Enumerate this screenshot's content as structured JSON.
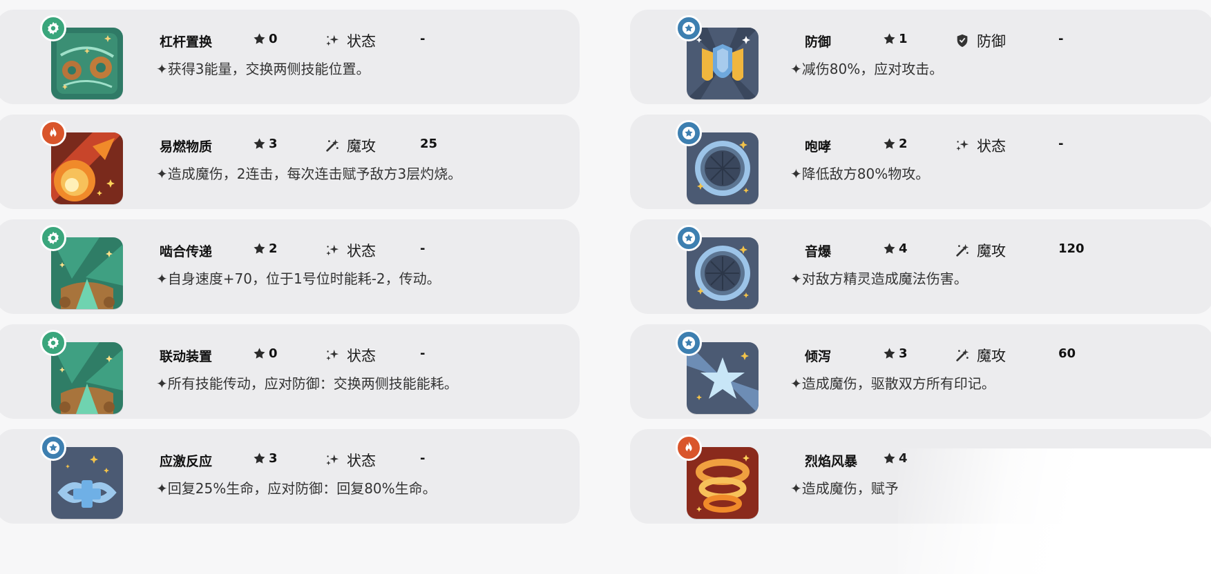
{
  "colors": {
    "card_bg": "#ececee",
    "badge_gear": "#3aa67c",
    "badge_star": "#3d7fb0",
    "badge_fire": "#d9552b",
    "text": "#111111"
  },
  "skills": [
    {
      "name": "杠杆置换",
      "cost": "0",
      "type_icon": "sparkle-icon",
      "type": "状态",
      "power": "-",
      "desc": "✦获得3能量，交换两侧技能位置。",
      "badge": "gear",
      "art": "mech"
    },
    {
      "name": "防御",
      "cost": "1",
      "type_icon": "shield-icon",
      "type": "防御",
      "power": "-",
      "desc": "✦减伤80%，应对攻击。",
      "badge": "star",
      "art": "shield"
    },
    {
      "name": "易燃物质",
      "cost": "3",
      "type_icon": "magic-attack-icon",
      "type": "魔攻",
      "power": "25",
      "desc": "✦造成魔伤，2连击，每次连击赋予敌方3层灼烧。",
      "badge": "fire",
      "art": "fire"
    },
    {
      "name": "咆哮",
      "cost": "2",
      "type_icon": "sparkle-icon",
      "type": "状态",
      "power": "-",
      "desc": "✦降低敌方80%物攻。",
      "badge": "star",
      "art": "sound"
    },
    {
      "name": "啮合传递",
      "cost": "2",
      "type_icon": "sparkle-icon",
      "type": "状态",
      "power": "-",
      "desc": "✦自身速度+70，位于1号位时能耗-2，传动。",
      "badge": "gear",
      "art": "leaf"
    },
    {
      "name": "音爆",
      "cost": "4",
      "type_icon": "magic-attack-icon",
      "type": "魔攻",
      "power": "120",
      "desc": "✦对敌方精灵造成魔法伤害。",
      "badge": "star",
      "art": "sound"
    },
    {
      "name": "联动装置",
      "cost": "0",
      "type_icon": "sparkle-icon",
      "type": "状态",
      "power": "-",
      "desc": "✦所有技能传动，应对防御：交换两侧技能能耗。",
      "badge": "gear",
      "art": "leaf"
    },
    {
      "name": "倾泻",
      "cost": "3",
      "type_icon": "magic-attack-icon",
      "type": "魔攻",
      "power": "60",
      "desc": "✦造成魔伤，驱散双方所有印记。",
      "badge": "star",
      "art": "burst"
    },
    {
      "name": "应激反应",
      "cost": "3",
      "type_icon": "sparkle-icon",
      "type": "状态",
      "power": "-",
      "desc": "✦回复25%生命，应对防御：回复80%生命。",
      "badge": "star",
      "art": "heal"
    },
    {
      "name": "烈焰风暴",
      "cost": "4",
      "type_icon": "",
      "type": "",
      "power": "",
      "desc": "✦造成魔伤，赋予",
      "badge": "fire",
      "art": "storm"
    }
  ]
}
